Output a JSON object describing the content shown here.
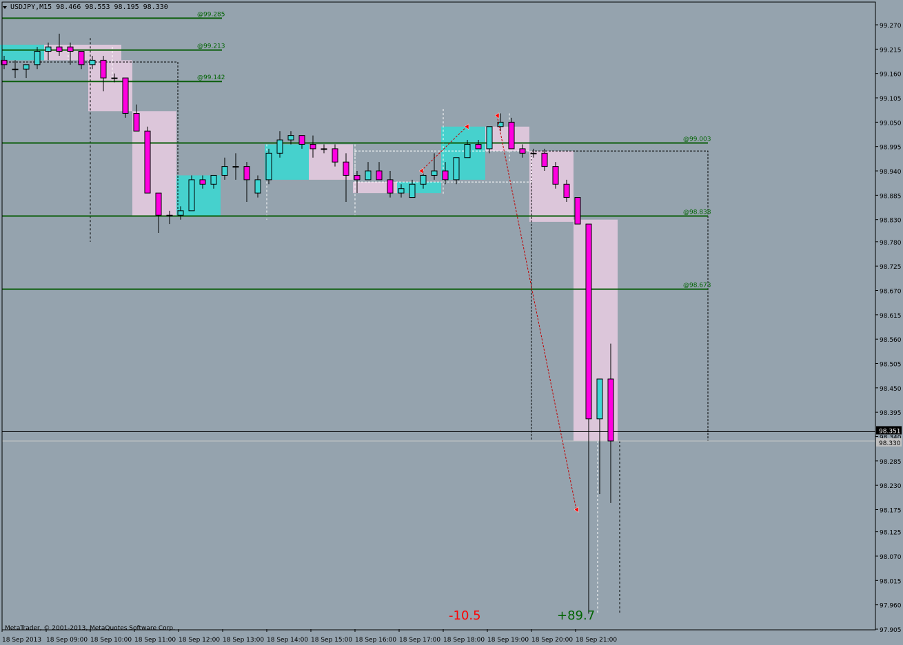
{
  "header": {
    "symbol_line": "USDJPY,M15  98.466 98.553 98.195 98.330",
    "menu_icon": "triangle-down-icon"
  },
  "footer": {
    "copyright": "MetaTrader, © 2001-2013, MetaQuotes Software Corp."
  },
  "colors": {
    "background": "#95a3ae",
    "bull": "#3fd6d3",
    "bear": "#ff00e0",
    "zone_bull": "#46d1cd",
    "zone_bear": "#dcc6da",
    "level_line": "#0b5e0b",
    "label_green": "#006400",
    "label_red": "#ff0000",
    "grid_text": "#000000"
  },
  "chart_data": {
    "type": "candlestick",
    "symbol": "USDJPY",
    "timeframe": "M15",
    "ohlc_header": {
      "open": 98.466,
      "high": 98.553,
      "low": 98.195,
      "close": 98.33
    },
    "ylim": [
      97.905,
      99.3
    ],
    "y_ticks": [
      "99.270",
      "99.215",
      "99.160",
      "99.105",
      "99.050",
      "98.995",
      "98.940",
      "98.885",
      "98.830",
      "98.780",
      "98.725",
      "98.670",
      "98.615",
      "98.560",
      "98.505",
      "98.450",
      "98.395",
      "98.340",
      "98.285",
      "98.230",
      "98.175",
      "98.125",
      "98.070",
      "98.015",
      "97.960",
      "97.905"
    ],
    "x_labels": [
      "18 Sep 2013",
      "18 Sep 09:00",
      "18 Sep 10:00",
      "18 Sep 11:00",
      "18 Sep 12:00",
      "18 Sep 13:00",
      "18 Sep 14:00",
      "18 Sep 15:00",
      "18 Sep 16:00",
      "18 Sep 17:00",
      "18 Sep 18:00",
      "18 Sep 19:00",
      "18 Sep 20:00",
      "18 Sep 21:00"
    ],
    "price_labels": [
      {
        "text": "98.351",
        "value": 98.351
      },
      {
        "text": "98.330",
        "value": 98.33
      }
    ],
    "levels": [
      {
        "label": "@99.285",
        "value": 99.285,
        "span": "short"
      },
      {
        "label": "@99.213",
        "value": 99.213,
        "span": "short"
      },
      {
        "label": "@99.142",
        "value": 99.142,
        "span": "short"
      },
      {
        "label": "@99.003",
        "value": 99.003,
        "span": "long"
      },
      {
        "label": "@98.838",
        "value": 98.838,
        "span": "long"
      },
      {
        "label": "@98.673",
        "value": 98.673,
        "span": "long"
      }
    ],
    "candles": [
      [
        99.19,
        99.2,
        99.17,
        99.18
      ],
      [
        99.17,
        99.19,
        99.15,
        99.17
      ],
      [
        99.17,
        99.18,
        99.15,
        99.18
      ],
      [
        99.18,
        99.22,
        99.17,
        99.21
      ],
      [
        99.21,
        99.23,
        99.19,
        99.22
      ],
      [
        99.22,
        99.25,
        99.2,
        99.21
      ],
      [
        99.22,
        99.23,
        99.18,
        99.21
      ],
      [
        99.21,
        99.21,
        99.17,
        99.18
      ],
      [
        99.18,
        99.2,
        99.17,
        99.19
      ],
      [
        99.19,
        99.2,
        99.12,
        99.15
      ],
      [
        99.15,
        99.16,
        99.14,
        99.15
      ],
      [
        99.15,
        99.15,
        99.06,
        99.07
      ],
      [
        99.07,
        99.09,
        99.03,
        99.03
      ],
      [
        99.03,
        99.04,
        98.89,
        98.89
      ],
      [
        98.89,
        98.89,
        98.8,
        98.84
      ],
      [
        98.84,
        98.85,
        98.82,
        98.84
      ],
      [
        98.84,
        98.86,
        98.83,
        98.85
      ],
      [
        98.85,
        98.93,
        98.85,
        98.92
      ],
      [
        98.92,
        98.93,
        98.9,
        98.91
      ],
      [
        98.91,
        98.93,
        98.9,
        98.93
      ],
      [
        98.93,
        98.97,
        98.92,
        98.95
      ],
      [
        98.95,
        98.98,
        98.92,
        98.95
      ],
      [
        98.95,
        98.96,
        98.87,
        98.92
      ],
      [
        98.89,
        98.93,
        98.88,
        98.92
      ],
      [
        98.92,
        98.99,
        98.91,
        98.98
      ],
      [
        98.98,
        99.03,
        98.97,
        99.01
      ],
      [
        99.01,
        99.03,
        99.0,
        99.02
      ],
      [
        99.02,
        99.02,
        98.99,
        99.0
      ],
      [
        99.0,
        99.02,
        98.97,
        98.99
      ],
      [
        98.99,
        99.0,
        98.98,
        98.99
      ],
      [
        98.99,
        99.0,
        98.95,
        98.96
      ],
      [
        98.96,
        98.98,
        98.87,
        98.93
      ],
      [
        98.93,
        98.94,
        98.89,
        98.92
      ],
      [
        98.92,
        98.96,
        98.92,
        98.94
      ],
      [
        98.94,
        98.96,
        98.92,
        98.92
      ],
      [
        98.92,
        98.94,
        98.88,
        98.89
      ],
      [
        98.89,
        98.91,
        98.88,
        98.9
      ],
      [
        98.88,
        98.92,
        98.88,
        98.91
      ],
      [
        98.91,
        98.94,
        98.9,
        98.93
      ],
      [
        98.93,
        98.98,
        98.92,
        98.94
      ],
      [
        98.94,
        98.96,
        98.91,
        98.92
      ],
      [
        98.92,
        98.97,
        98.91,
        98.97
      ],
      [
        98.97,
        99.01,
        98.97,
        99.0
      ],
      [
        99.0,
        99.01,
        98.99,
        98.99
      ],
      [
        98.99,
        99.04,
        98.98,
        99.04
      ],
      [
        99.04,
        99.07,
        99.03,
        99.05
      ],
      [
        99.05,
        99.06,
        98.99,
        98.99
      ],
      [
        98.99,
        99.0,
        98.97,
        98.98
      ],
      [
        98.98,
        98.99,
        98.97,
        98.98
      ],
      [
        98.98,
        98.99,
        98.94,
        98.95
      ],
      [
        98.95,
        98.96,
        98.9,
        98.91
      ],
      [
        98.91,
        98.92,
        98.87,
        98.88
      ],
      [
        98.88,
        98.88,
        98.82,
        98.82
      ],
      [
        98.82,
        98.82,
        97.94,
        98.38
      ],
      [
        98.38,
        98.47,
        98.21,
        98.47
      ],
      [
        98.47,
        98.55,
        98.19,
        98.33
      ]
    ],
    "trade_labels": [
      {
        "text": "-10.5",
        "value": -10.5
      },
      {
        "text": "+89.7",
        "value": 89.7
      }
    ]
  }
}
